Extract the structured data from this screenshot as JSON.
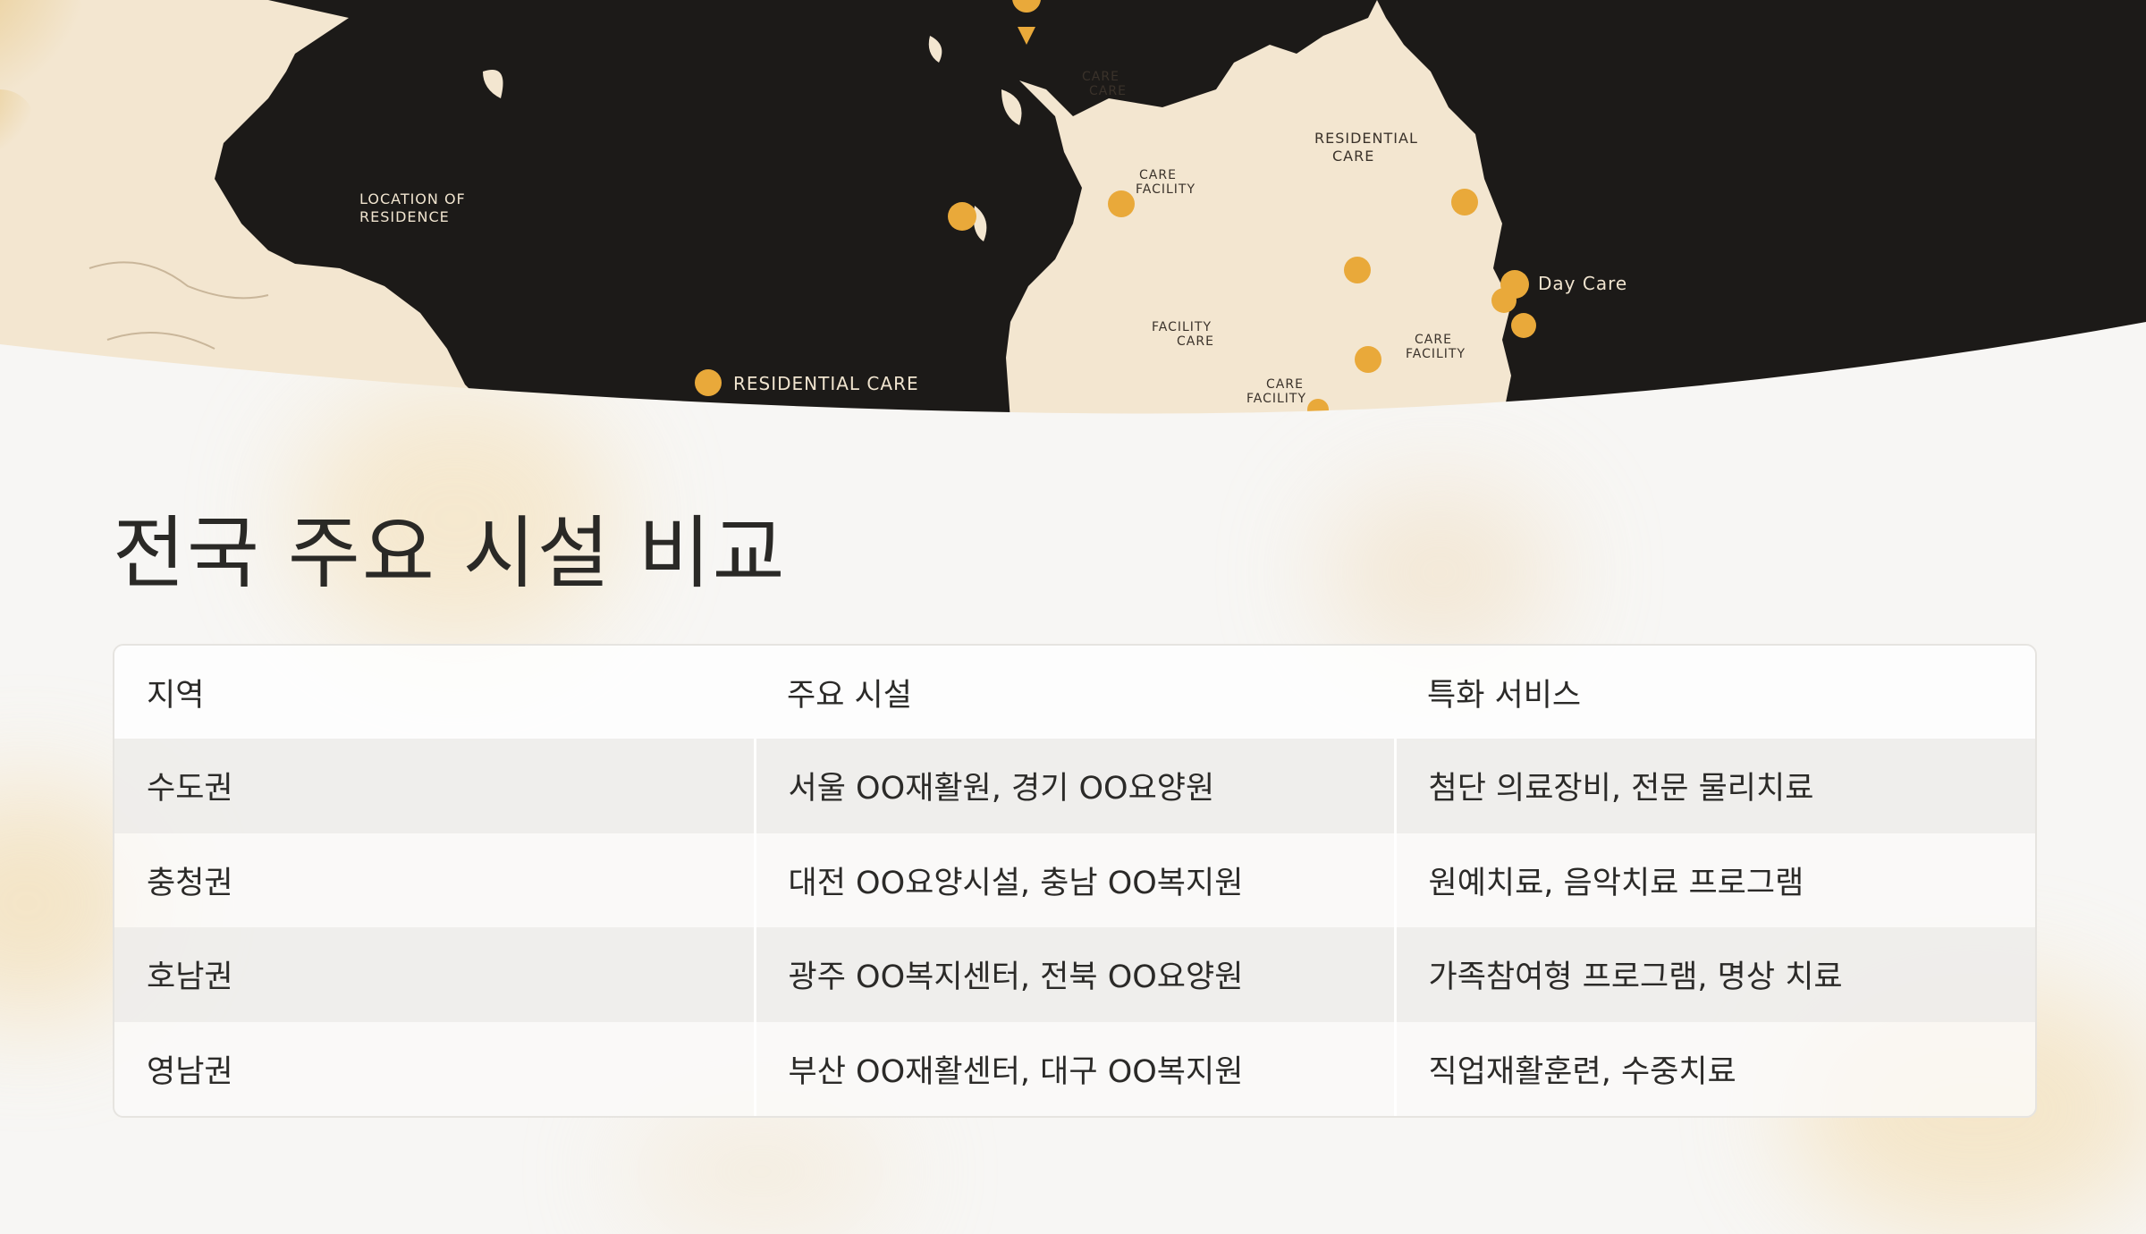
{
  "colors": {
    "land_light": "#f3e6d0",
    "sea_dark": "#1c1a18",
    "pin": "#e9a93a",
    "page_bg": "#f7f6f4",
    "accent_glow": "#f5d9a6"
  },
  "map": {
    "labels": {
      "location_of_residence": "LOCATION OF\nRESIDENCE",
      "residential_care_top": "RESIDENTIAL\nCARE",
      "day_care": "Day Care",
      "residential_care_bottom": "RESIDENTIAL CARE",
      "care_1": "CARE\nCARE",
      "care_2": "CARE\nFACILITY",
      "care_3": "FACILITY\nCARE",
      "care_4": "CARE\nFACILITY",
      "care_5": "CARE\nFACILITY"
    }
  },
  "page": {
    "title": "전국 주요 시설 비교"
  },
  "table": {
    "headers": [
      "지역",
      "주요 시설",
      "특화 서비스"
    ],
    "rows": [
      [
        "수도권",
        "서울 OO재활원, 경기 OO요양원",
        "첨단 의료장비, 전문 물리치료"
      ],
      [
        "충청권",
        "대전 OO요양시설, 충남 OO복지원",
        "원예치료, 음악치료 프로그램"
      ],
      [
        "호남권",
        "광주 OO복지센터, 전북 OO요양원",
        "가족참여형 프로그램, 명상 치료"
      ],
      [
        "영남권",
        "부산 OO재활센터, 대구 OO복지원",
        "직업재활훈련, 수중치료"
      ]
    ]
  }
}
